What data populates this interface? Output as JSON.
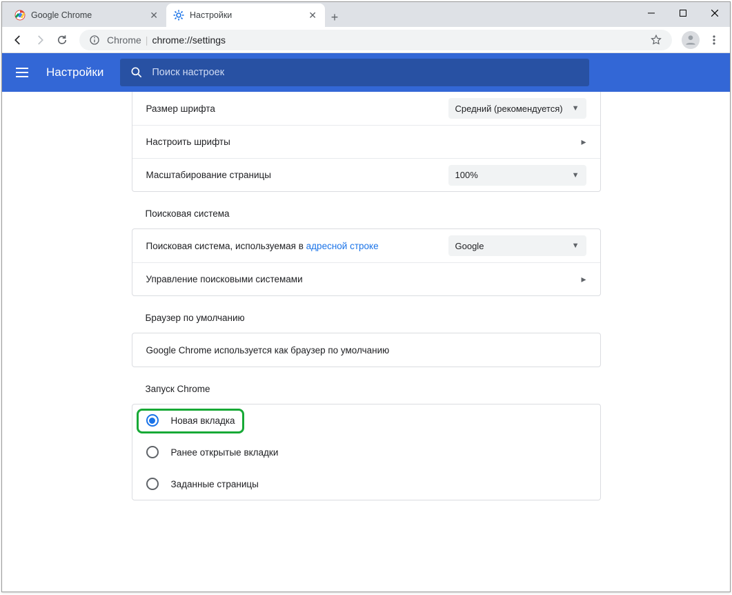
{
  "window": {
    "controls": {
      "minimize": "—",
      "maximize": "□",
      "close": "✕"
    }
  },
  "tabs": [
    {
      "title": "Google Chrome",
      "favicon": "chrome",
      "active": false
    },
    {
      "title": "Настройки",
      "favicon": "gear",
      "active": true
    }
  ],
  "toolbar": {
    "chrome_label": "Chrome",
    "url": "chrome://settings"
  },
  "header": {
    "title": "Настройки",
    "search_placeholder": "Поиск настроек"
  },
  "sections": {
    "appearance": {
      "font_size_label": "Размер шрифта",
      "font_size_value": "Средний (рекомендуется)",
      "customize_fonts_label": "Настроить шрифты",
      "page_zoom_label": "Масштабирование страницы",
      "page_zoom_value": "100%"
    },
    "search_engine": {
      "title": "Поисковая система",
      "used_in_label_prefix": "Поисковая система, используемая в ",
      "used_in_link": "адресной строке",
      "engine_value": "Google",
      "manage_label": "Управление поисковыми системами"
    },
    "default_browser": {
      "title": "Браузер по умолчанию",
      "status": "Google Chrome используется как браузер по умолчанию"
    },
    "on_startup": {
      "title": "Запуск Chrome",
      "options": [
        {
          "label": "Новая вкладка",
          "checked": true
        },
        {
          "label": "Ранее открытые вкладки",
          "checked": false
        },
        {
          "label": "Заданные страницы",
          "checked": false
        }
      ]
    }
  }
}
